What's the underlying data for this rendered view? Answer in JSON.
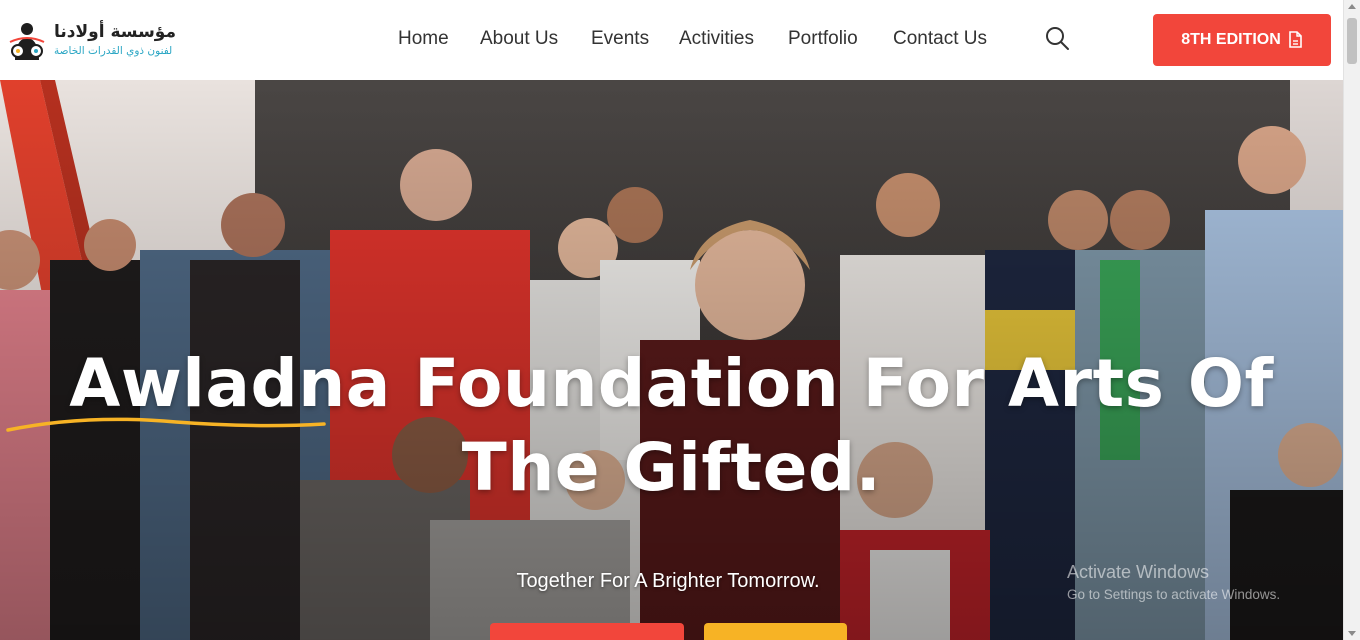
{
  "header": {
    "logo": {
      "name_ar": "مؤسسة أولادنا",
      "subtitle_ar": "لفنون ذوي القدرات الخاصة"
    },
    "nav": [
      {
        "label": "Home"
      },
      {
        "label": "About Us"
      },
      {
        "label": "Events"
      },
      {
        "label": "Activities"
      },
      {
        "label": "Portfolio"
      },
      {
        "label": "Contact Us"
      }
    ],
    "search_icon": "search-icon",
    "edition_button": {
      "label": "8TH EDITION",
      "icon": "document-icon"
    }
  },
  "hero": {
    "title": "Awladna Foundation For Arts Of The Gifted.",
    "tagline": "Together For A Brighter Tomorrow."
  },
  "watermark": {
    "title": "Activate Windows",
    "subtitle": "Go to Settings to activate Windows."
  },
  "colors": {
    "accent_red": "#f2463b",
    "accent_yellow": "#f7b325",
    "logo_teal": "#2aa6c4"
  }
}
